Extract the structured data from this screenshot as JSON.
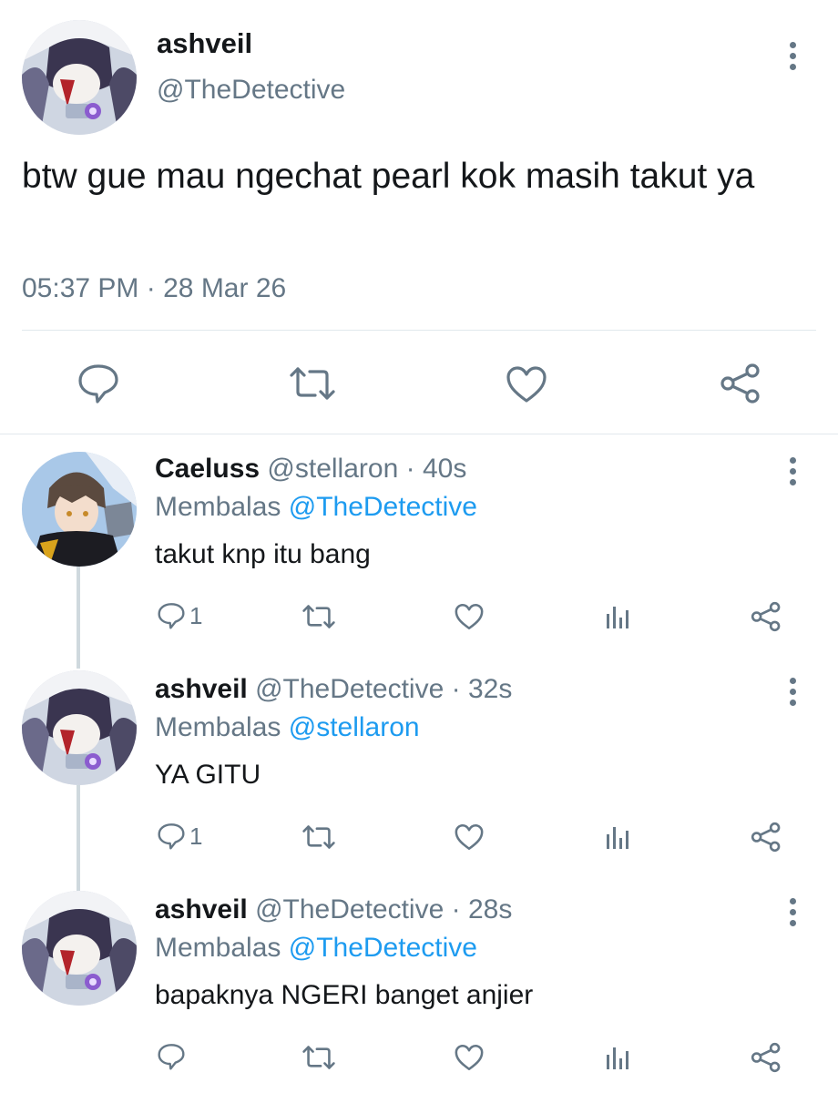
{
  "main_tweet": {
    "display_name": "ashveil",
    "handle": "@TheDetective",
    "text": "btw gue mau ngechat pearl kok masih takut ya",
    "time": "05:37 PM",
    "separator": "·",
    "date": "28 Mar 26",
    "actions": [
      "reply-icon",
      "retweet-icon",
      "like-icon",
      "share-icon"
    ]
  },
  "replies": [
    {
      "display_name": "Caeluss",
      "handle": "@stellaron",
      "sep": "·",
      "age": "40s",
      "replying_prefix": "Membalas",
      "replying_to": "@TheDetective",
      "text": "takut knp itu bang",
      "reply_count": "1"
    },
    {
      "display_name": "ashveil",
      "handle": "@TheDetective",
      "sep": "·",
      "age": "32s",
      "replying_prefix": "Membalas",
      "replying_to": "@stellaron",
      "text": "YA GITU",
      "reply_count": "1"
    },
    {
      "display_name": "ashveil",
      "handle": "@TheDetective",
      "sep": "·",
      "age": "28s",
      "replying_prefix": "Membalas",
      "replying_to": "@TheDetective",
      "text": "bapaknya NGERI banget anjier",
      "reply_count": ""
    }
  ],
  "colors": {
    "text": "#14171a",
    "secondary": "#657786",
    "link": "#1d9bf0",
    "divider": "#e1e8ed"
  }
}
